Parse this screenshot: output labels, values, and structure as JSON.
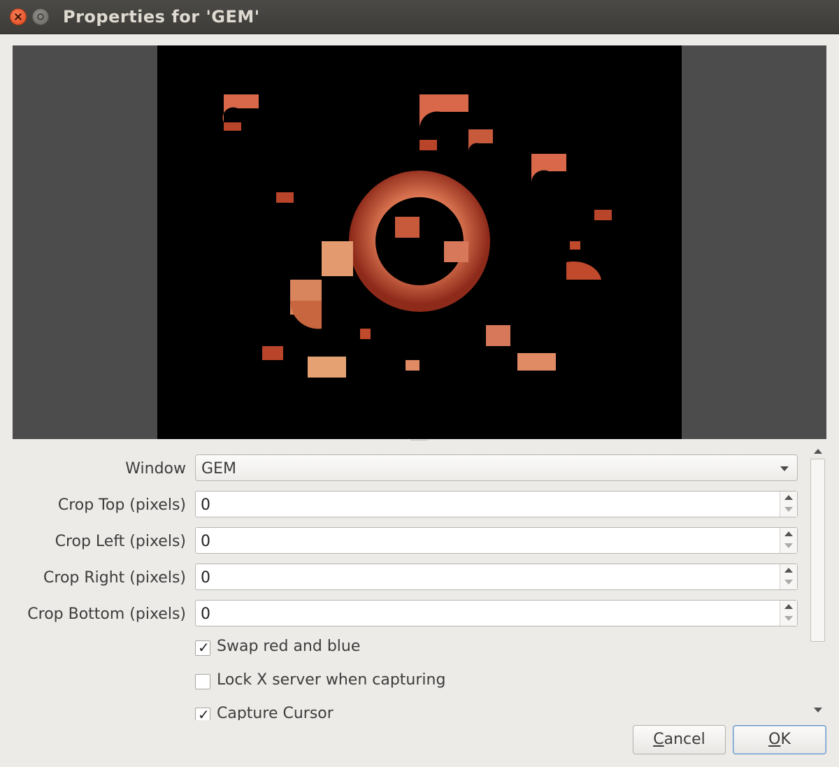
{
  "window": {
    "title": "Properties for 'GEM'",
    "close_icon": "close-icon",
    "minimize_icon": "minimize-icon"
  },
  "preview": {
    "pillarbox_color": "#4c4c4c",
    "frame_color": "#000000",
    "accent_color": "#d9593a"
  },
  "form": {
    "window_field": {
      "label": "Window",
      "value": "GEM"
    },
    "crop_top": {
      "label": "Crop Top (pixels)",
      "value": "0"
    },
    "crop_left": {
      "label": "Crop Left (pixels)",
      "value": "0"
    },
    "crop_right": {
      "label": "Crop Right (pixels)",
      "value": "0"
    },
    "crop_bottom": {
      "label": "Crop Bottom (pixels)",
      "value": "0"
    },
    "swap_red_blue": {
      "label": "Swap red and blue",
      "checked": true
    },
    "lock_x_server": {
      "label": "Lock X server when capturing",
      "checked": false
    },
    "capture_cursor": {
      "label": "Capture Cursor",
      "checked": true
    }
  },
  "buttons": {
    "cancel": {
      "mnemonic": "C",
      "rest": "ancel"
    },
    "ok": {
      "mnemonic": "O",
      "rest": "K"
    }
  }
}
